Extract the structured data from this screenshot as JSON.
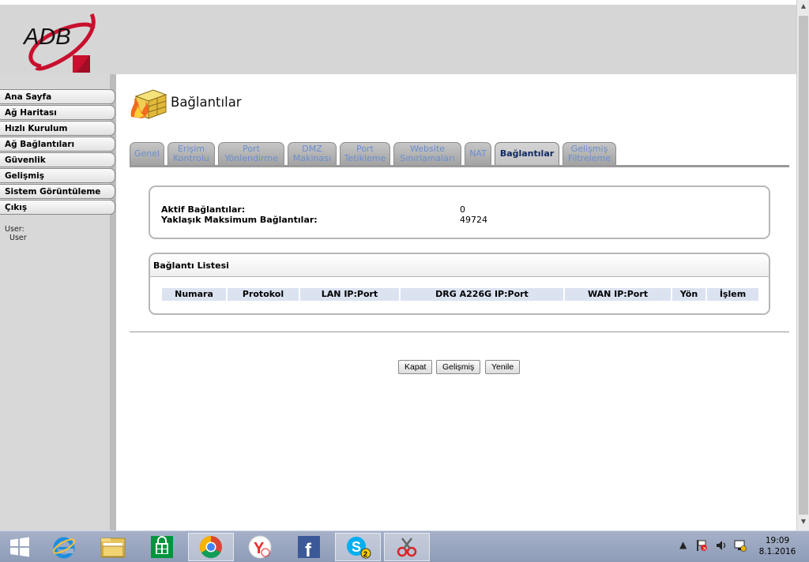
{
  "header": {
    "logo_text": "ADB"
  },
  "sidebar": {
    "items": [
      {
        "label": "Ana Sayfa"
      },
      {
        "label": "Ağ Haritası"
      },
      {
        "label": "Hızlı Kurulum"
      },
      {
        "label": "Ağ Bağlantıları"
      },
      {
        "label": "Güvenlik"
      },
      {
        "label": "Gelişmiş"
      },
      {
        "label": "Sistem Görüntüleme"
      },
      {
        "label": "Çıkış"
      }
    ],
    "user_label": "User:",
    "user_name": "User"
  },
  "page": {
    "title": "Bağlantılar"
  },
  "tabs": [
    {
      "label": "Genel"
    },
    {
      "label": "Erişim\nKontrolu"
    },
    {
      "label": "Port\nYönlendirme"
    },
    {
      "label": "DMZ\nMakinası"
    },
    {
      "label": "Port\nTetikleme"
    },
    {
      "label": "Website\nSınırlamaları"
    },
    {
      "label": "NAT"
    },
    {
      "label": "Bağlantılar",
      "active": true
    },
    {
      "label": "Gelişmiş\nFiltreleme"
    }
  ],
  "info": {
    "active_label": "Aktif Bağlantılar:",
    "active_value": "0",
    "max_label": "Yaklaşık Maksimum Bağlantılar:",
    "max_value": "49724"
  },
  "list": {
    "title": "Bağlantı Listesi",
    "columns": [
      "Numara",
      "Protokol",
      "LAN IP:Port",
      "DRG A226G IP:Port",
      "WAN IP:Port",
      "Yön",
      "İşlem"
    ]
  },
  "buttons": {
    "close": "Kapat",
    "advanced": "Gelişmiş",
    "refresh": "Yenile"
  },
  "taskbar": {
    "apps": [
      "windows-start",
      "internet-explorer",
      "file-explorer",
      "windows-store",
      "google-chrome",
      "yandex-browser",
      "facebook",
      "skype",
      "snipping-tool"
    ],
    "skype_badge": "2",
    "time": "19:09",
    "date": "8.1.2016"
  },
  "colors": {
    "accent_tab": "#102a62",
    "tab_text": "#6a8ed0",
    "table_header_bg": "#dbe3f1"
  }
}
